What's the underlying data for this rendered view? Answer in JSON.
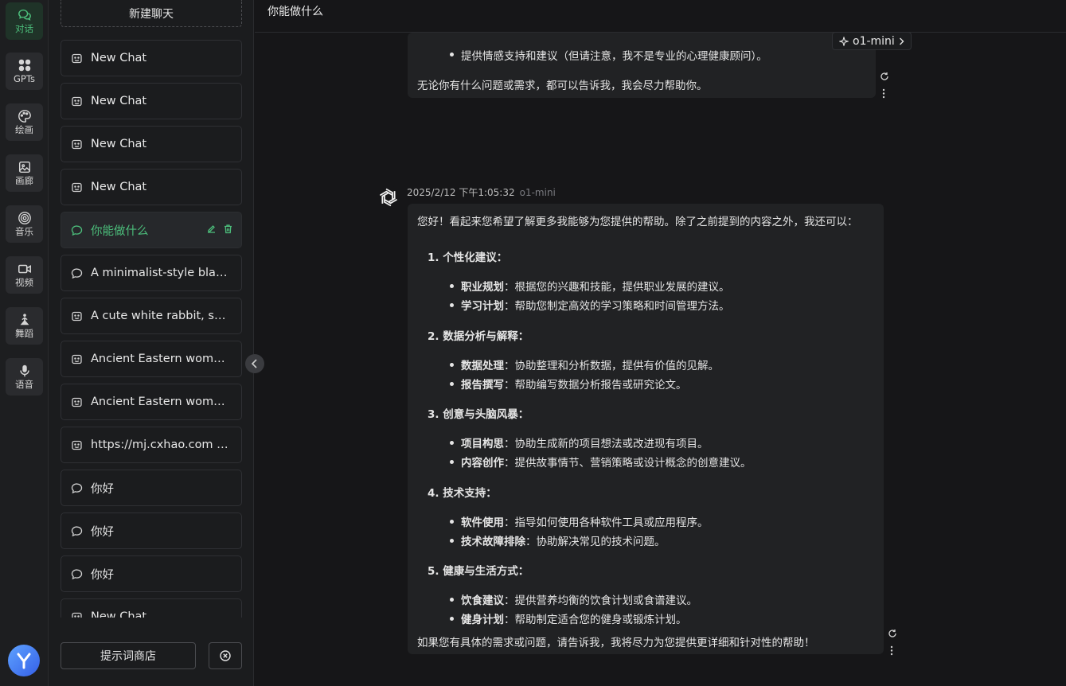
{
  "rail": [
    {
      "label": "对话",
      "icon": "chat-icon",
      "active": true
    },
    {
      "label": "GPTs",
      "icon": "grid-icon"
    },
    {
      "label": "绘画",
      "icon": "palette-icon"
    },
    {
      "label": "画廊",
      "icon": "image-icon"
    },
    {
      "label": "音乐",
      "icon": "music-icon"
    },
    {
      "label": "视频",
      "icon": "video-icon"
    },
    {
      "label": "舞蹈",
      "icon": "dance-icon"
    },
    {
      "label": "语音",
      "icon": "mic-icon"
    }
  ],
  "sidebar": {
    "new_chat": "新建聊天",
    "items": [
      {
        "label": "New Chat",
        "icon": "image-chat-icon"
      },
      {
        "label": "New Chat",
        "icon": "image-chat-icon"
      },
      {
        "label": "New Chat",
        "icon": "image-chat-icon"
      },
      {
        "label": "New Chat",
        "icon": "image-chat-icon"
      },
      {
        "label": "你能做什么",
        "icon": "chat-bubble-icon",
        "active": true
      },
      {
        "label": "A minimalist-style black …",
        "icon": "chat-bubble-icon"
      },
      {
        "label": "A cute white rabbit, surr…",
        "icon": "image-chat-icon"
      },
      {
        "label": "Ancient Eastern woman,…",
        "icon": "image-chat-icon"
      },
      {
        "label": "Ancient Eastern woman,…",
        "icon": "image-chat-icon"
      },
      {
        "label": "https://mj.cxhao.com --…",
        "icon": "image-chat-icon"
      },
      {
        "label": "你好",
        "icon": "chat-bubble-icon"
      },
      {
        "label": "你好",
        "icon": "chat-bubble-icon"
      },
      {
        "label": "你好",
        "icon": "chat-bubble-icon"
      },
      {
        "label": "New Chat",
        "icon": "image-chat-icon"
      }
    ],
    "prompt_store": "提示词商店"
  },
  "header": {
    "title": "你能做什么"
  },
  "model_chip": "o1-mini",
  "prev_message": {
    "bullet": "提供情感支持和建议（但请注意，我不是专业的心理健康顾问）。",
    "closing": "无论你有什么问题或需求，都可以告诉我，我会尽力帮助你。"
  },
  "message": {
    "timestamp": "2025/2/12 下午1:05:32",
    "model": "o1-mini",
    "intro": "您好！看起来您希望了解更多我能够为您提供的帮助。除了之前提到的内容之外，我还可以：",
    "sections": [
      {
        "title": "1. 个性化建议：",
        "items": [
          {
            "b": "职业规划",
            "t": "：根据您的兴趣和技能，提供职业发展的建议。"
          },
          {
            "b": "学习计划",
            "t": "：帮助您制定高效的学习策略和时间管理方法。"
          }
        ]
      },
      {
        "title": "2. 数据分析与解释：",
        "items": [
          {
            "b": "数据处理",
            "t": "：协助整理和分析数据，提供有价值的见解。"
          },
          {
            "b": "报告撰写",
            "t": "：帮助编写数据分析报告或研究论文。"
          }
        ]
      },
      {
        "title": "3. 创意与头脑风暴：",
        "items": [
          {
            "b": "项目构思",
            "t": "：协助生成新的项目想法或改进现有项目。"
          },
          {
            "b": "内容创作",
            "t": "：提供故事情节、营销策略或设计概念的创意建议。"
          }
        ]
      },
      {
        "title": "4. 技术支持：",
        "items": [
          {
            "b": "软件使用",
            "t": "：指导如何使用各种软件工具或应用程序。"
          },
          {
            "b": "技术故障排除",
            "t": "：协助解决常见的技术问题。"
          }
        ]
      },
      {
        "title": "5. 健康与生活方式：",
        "items": [
          {
            "b": "饮食建议",
            "t": "：提供营养均衡的饮食计划或食谱建议。"
          },
          {
            "b": "健身计划",
            "t": "：帮助制定适合您的健身或锻炼计划。"
          }
        ]
      }
    ],
    "closing": "如果您有具体的需求或问题，请告诉我，我将尽力为您提供更详细和针对性的帮助！"
  }
}
